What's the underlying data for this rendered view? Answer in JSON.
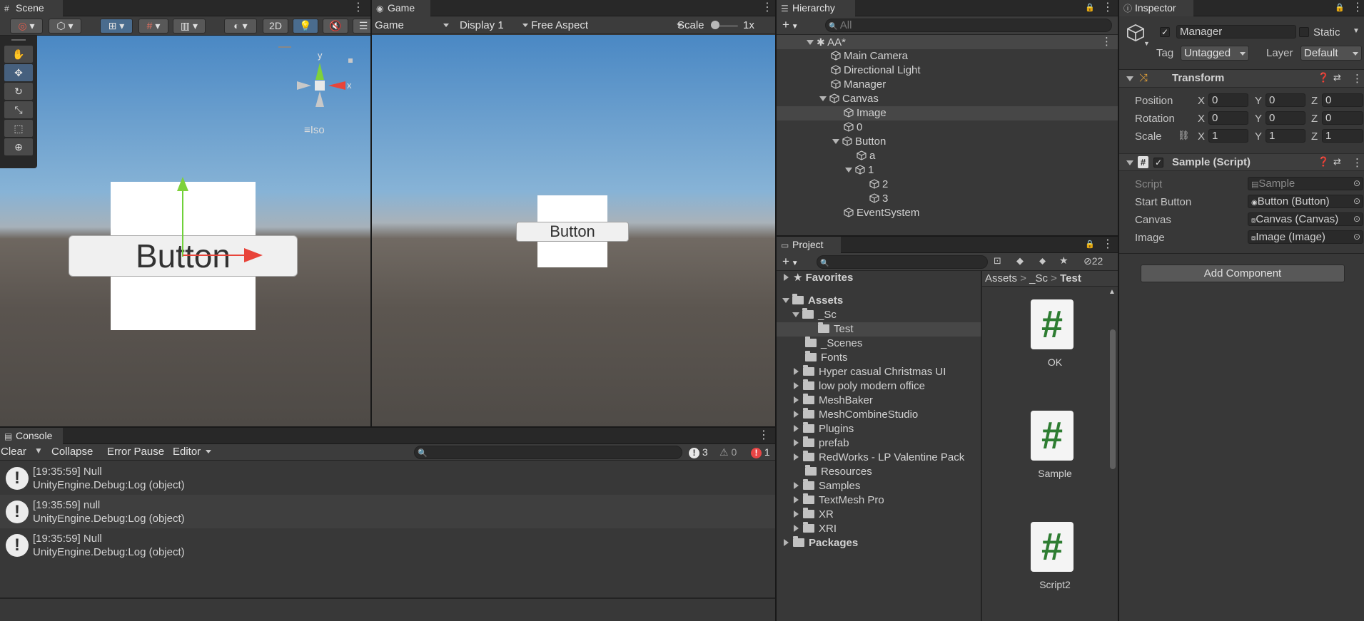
{
  "scene": {
    "tab_label": "Scene",
    "mode_2d": "2D",
    "iso_label": "Iso",
    "axis_y": "y",
    "axis_x": "x",
    "button_text": "Button"
  },
  "game": {
    "tab_label": "Game",
    "view_dropdown": "Game",
    "display_dropdown": "Display 1",
    "aspect_dropdown": "Free Aspect",
    "scale_label": "Scale",
    "scale_value": "1x",
    "scale_level": 0,
    "button_text": "Button"
  },
  "hierarchy": {
    "tab_label": "Hierarchy",
    "search_placeholder": "All",
    "scene_name": "AA*",
    "items": {
      "main_camera": "Main Camera",
      "directional_light": "Directional Light",
      "manager": "Manager",
      "canvas": "Canvas",
      "image": "Image",
      "zero": "0",
      "button": "Button",
      "a": "a",
      "one": "1",
      "two": "2",
      "three": "3",
      "event_system": "EventSystem"
    }
  },
  "inspector": {
    "tab_label": "Inspector",
    "object_name": "Manager",
    "static_label": "Static",
    "tag_label": "Tag",
    "tag_value": "Untagged",
    "layer_label": "Layer",
    "layer_value": "Default",
    "transform": {
      "title": "Transform",
      "position_label": "Position",
      "rotation_label": "Rotation",
      "scale_label": "Scale",
      "x": "X",
      "y": "Y",
      "z": "Z",
      "position": [
        "0",
        "0",
        "0"
      ],
      "rotation": [
        "0",
        "0",
        "0"
      ],
      "scale": [
        "1",
        "1",
        "1"
      ]
    },
    "script_component": {
      "title": "Sample (Script)",
      "script_label": "Script",
      "script_value": "Sample",
      "start_button_label": "Start Button",
      "start_button_value": "Button (Button)",
      "canvas_label": "Canvas",
      "canvas_value": "Canvas (Canvas)",
      "image_label": "Image",
      "image_value": "Image (Image)"
    },
    "add_component": "Add Component"
  },
  "console": {
    "tab_label": "Console",
    "clear": "Clear",
    "collapse": "Collapse",
    "error_pause": "Error Pause",
    "editor": "Editor",
    "count_info": "3",
    "count_warn": "0",
    "count_error": "1",
    "logs": [
      {
        "line1": "[19:35:59] Null",
        "line2": "UnityEngine.Debug:Log (object)"
      },
      {
        "line1": "[19:35:59] null",
        "line2": "UnityEngine.Debug:Log (object)"
      },
      {
        "line1": "[19:35:59] Null",
        "line2": "UnityEngine.Debug:Log (object)"
      }
    ]
  },
  "project": {
    "tab_label": "Project",
    "hidden_count": "22",
    "favorites": "Favorites",
    "assets": "Assets",
    "folders": {
      "sc": "_Sc",
      "test": "Test",
      "scenes": "_Scenes",
      "fonts": "Fonts",
      "hyper": "Hyper casual Christmas UI",
      "lowpoly": "low poly modern office",
      "meshbaker": "MeshBaker",
      "meshcombine": "MeshCombineStudio",
      "plugins": "Plugins",
      "prefab": "prefab",
      "redworks": "RedWorks - LP Valentine Pack",
      "resources": "Resources",
      "samples": "Samples",
      "textmesh": "TextMesh Pro",
      "xr": "XR",
      "xri": "XRI"
    },
    "packages": "Packages",
    "breadcrumb": [
      "Assets",
      "_Sc",
      "Test"
    ],
    "files": [
      "OK",
      "Sample",
      "Script2"
    ]
  },
  "colors": {
    "selection": "#2c5d87",
    "tab_bg": "#3c3c3c",
    "panel_bg": "#383838",
    "script_hash": "#2e7d32"
  }
}
